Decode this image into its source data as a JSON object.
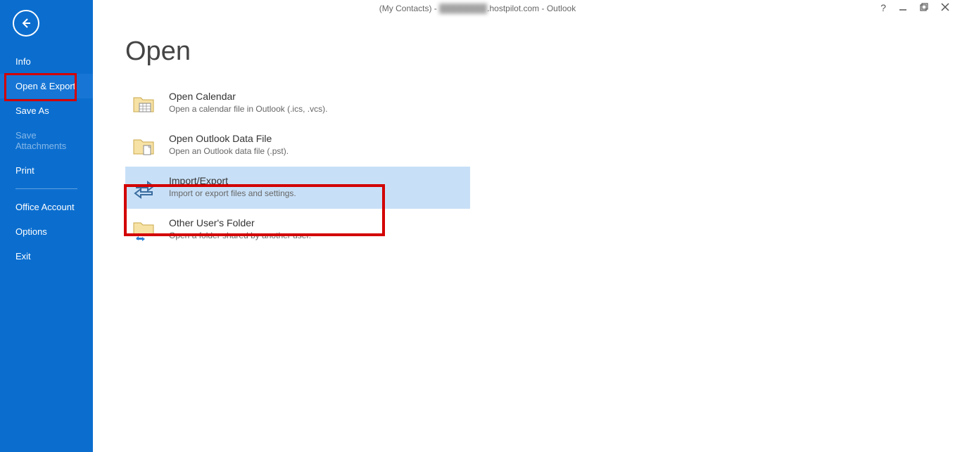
{
  "window": {
    "title_prefix": "(My Contacts) - ",
    "title_obscured": "████████",
    "title_suffix": ".hostpilot.com - Outlook"
  },
  "sidebar": {
    "items": [
      {
        "label": "Info",
        "disabled": false,
        "active": false
      },
      {
        "label": "Open & Export",
        "disabled": false,
        "active": true
      },
      {
        "label": "Save As",
        "disabled": false,
        "active": false
      },
      {
        "label": "Save Attachments",
        "disabled": true,
        "active": false
      },
      {
        "label": "Print",
        "disabled": false,
        "active": false
      }
    ],
    "lower": [
      {
        "label": "Office Account"
      },
      {
        "label": "Options"
      },
      {
        "label": "Exit"
      }
    ]
  },
  "page": {
    "title": "Open",
    "options": [
      {
        "title": "Open Calendar",
        "desc": "Open a calendar file in Outlook (.ics, .vcs).",
        "icon": "calendar-folder-icon",
        "highlight": false
      },
      {
        "title": "Open Outlook Data File",
        "desc": "Open an Outlook data file (.pst).",
        "icon": "data-file-folder-icon",
        "highlight": false
      },
      {
        "title": "Import/Export",
        "desc": "Import or export files and settings.",
        "icon": "import-export-icon",
        "highlight": true
      },
      {
        "title": "Other User's Folder",
        "desc": "Open a folder shared by another user.",
        "icon": "shared-folder-icon",
        "highlight": false
      }
    ]
  }
}
